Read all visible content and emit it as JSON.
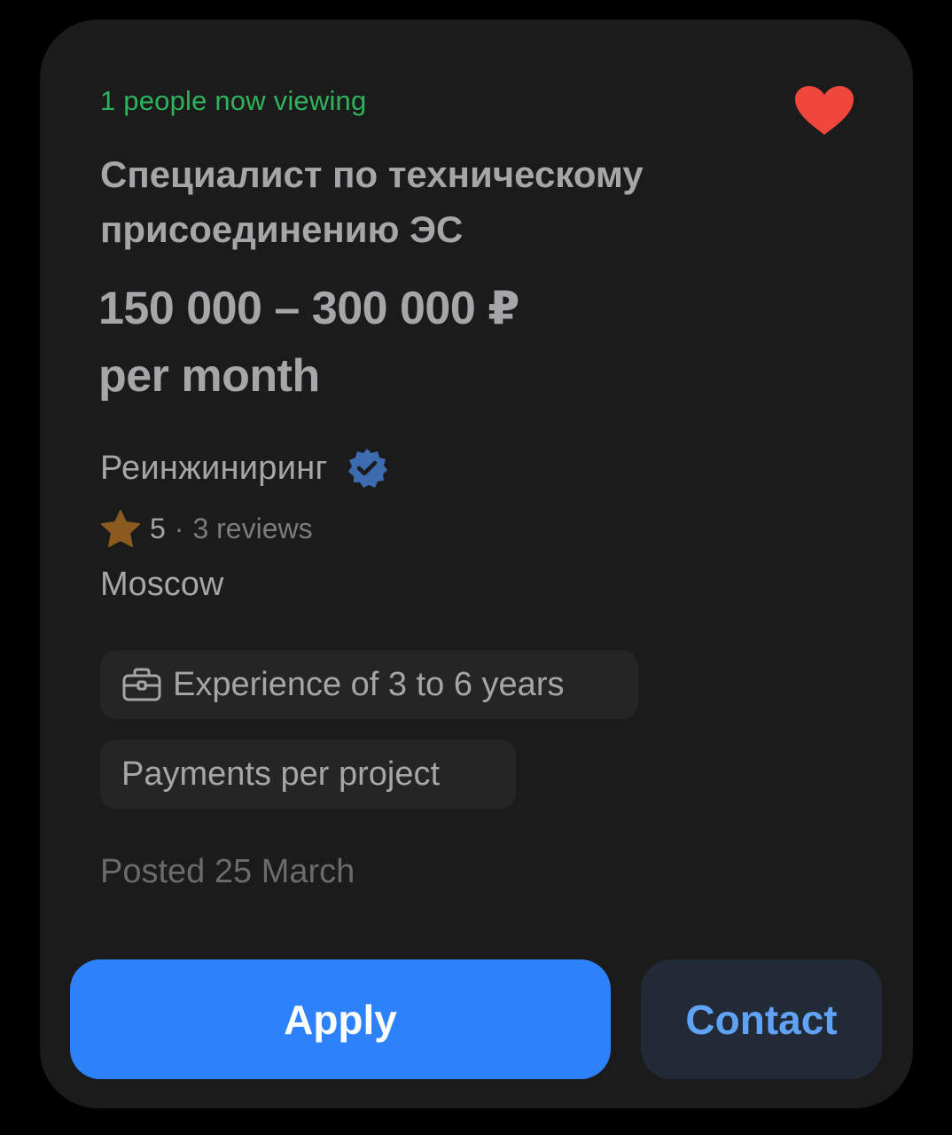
{
  "viewers_text": "1 people now viewing",
  "favorite": {
    "icon": "heart-icon",
    "active": true,
    "color": "#f0473c"
  },
  "vacancy": {
    "title": "Специалист по техническому присоединению ЭС",
    "salary_range": "150 000 – 300 000 ₽",
    "salary_period": "per month"
  },
  "company": {
    "name": "Реинжиниринг",
    "verified_icon": "verified-badge-icon",
    "rating": "5",
    "separator": "·",
    "reviews": "3 reviews",
    "city": "Moscow"
  },
  "tags": {
    "experience": "Experience of 3 to 6 years",
    "payments": "Payments per project"
  },
  "posted": "Posted 25 March",
  "actions": {
    "apply_label": "Apply",
    "contact_label": "Contact"
  },
  "colors": {
    "accent": "#2b82fb",
    "viewers": "#2fb35a",
    "verified": "#3d6bb0",
    "star": "#8a5a1e"
  }
}
